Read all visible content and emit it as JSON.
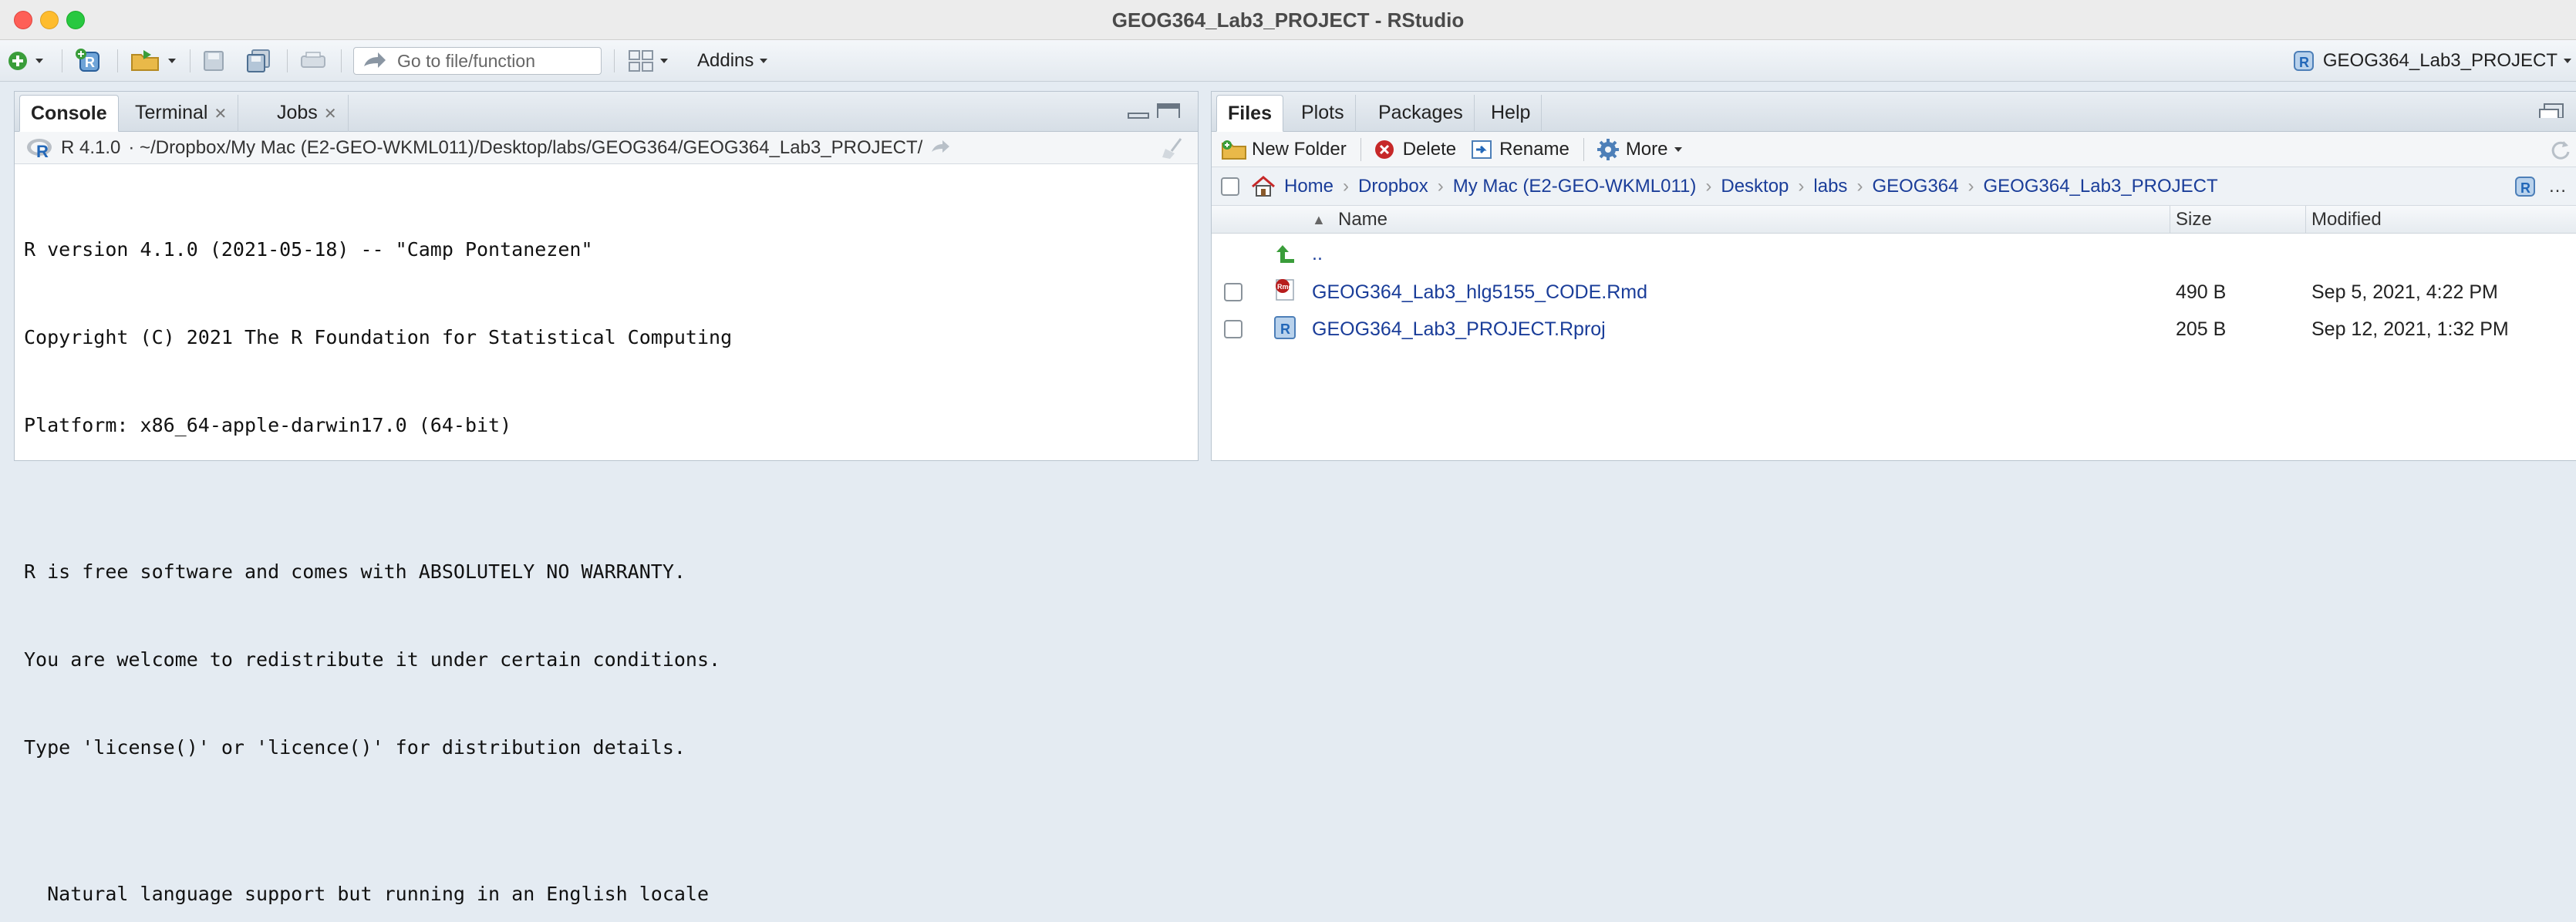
{
  "window": {
    "title": "GEOG364_Lab3_PROJECT - RStudio"
  },
  "toolbar": {
    "goto_placeholder": "Go to file/function",
    "addins_label": "Addins",
    "project_label": "GEOG364_Lab3_PROJECT"
  },
  "left_pane": {
    "tabs": [
      {
        "label": "Console"
      },
      {
        "label": "Terminal"
      },
      {
        "label": "Jobs"
      }
    ],
    "r_version": "R 4.1.0",
    "path": "· ~/Dropbox/My Mac (E2-GEO-WKML011)/Desktop/labs/GEOG364/GEOG364_Lab3_PROJECT/",
    "console_lines": [
      "R version 4.1.0 (2021-05-18) -- \"Camp Pontanezen\"",
      "Copyright (C) 2021 The R Foundation for Statistical Computing",
      "Platform: x86_64-apple-darwin17.0 (64-bit)",
      "",
      "R is free software and comes with ABSOLUTELY NO WARRANTY.",
      "You are welcome to redistribute it under certain conditions.",
      "Type 'license()' or 'licence()' for distribution details.",
      "",
      "  Natural language support but running in an English locale"
    ]
  },
  "right_pane": {
    "tabs": [
      {
        "label": "Files"
      },
      {
        "label": "Plots"
      },
      {
        "label": "Packages"
      },
      {
        "label": "Help"
      }
    ],
    "tools": {
      "new_folder": "New Folder",
      "delete": "Delete",
      "rename": "Rename",
      "more": "More"
    },
    "breadcrumb": [
      "Home",
      "Dropbox",
      "My Mac (E2-GEO-WKML011)",
      "Desktop",
      "labs",
      "GEOG364",
      "GEOG364_Lab3_PROJECT"
    ],
    "columns": {
      "name": "Name",
      "size": "Size",
      "modified": "Modified"
    },
    "parent_dir": "..",
    "files": [
      {
        "name": "GEOG364_Lab3_hlg5155_CODE.Rmd",
        "size": "490 B",
        "modified": "Sep 5, 2021, 4:22 PM",
        "icon": "rmd-file-icon"
      },
      {
        "name": "GEOG364_Lab3_PROJECT.Rproj",
        "size": "205 B",
        "modified": "Sep 12, 2021, 1:32 PM",
        "icon": "rproj-file-icon"
      }
    ]
  },
  "colors": {
    "link_blue": "#1a3d99",
    "close_red": "#fe5f57",
    "minimize_yellow": "#febc2e",
    "zoom_green": "#28c840",
    "r_blue": "#2267b8"
  }
}
